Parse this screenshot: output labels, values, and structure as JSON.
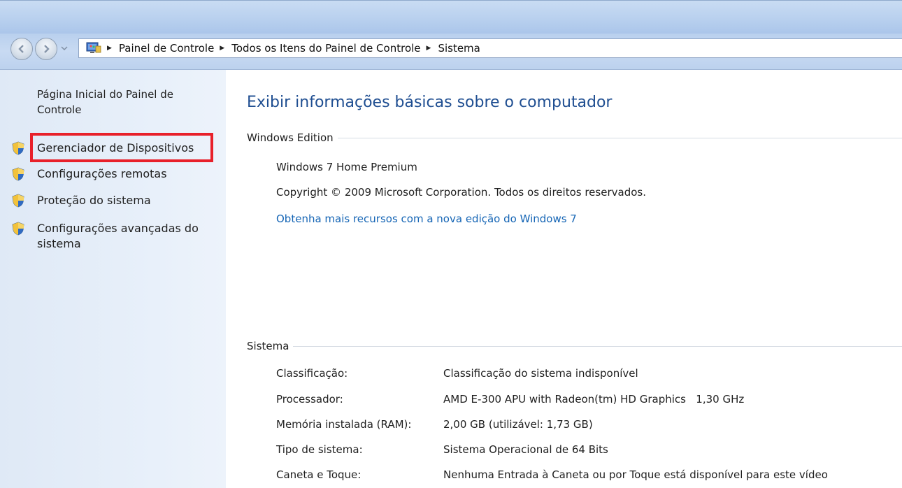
{
  "navigation": {
    "breadcrumbs": [
      "Painel de Controle",
      "Todos os Itens do Painel de Controle",
      "Sistema"
    ]
  },
  "sidebar": {
    "home_label": "Página Inicial do Painel de Controle",
    "items": [
      {
        "label": "Gerenciador de Dispositivos",
        "icon": "uac-shield-icon",
        "highlighted": true
      },
      {
        "label": "Configurações remotas",
        "icon": "uac-shield-icon"
      },
      {
        "label": "Proteção do sistema",
        "icon": "uac-shield-icon"
      },
      {
        "label": "Configurações avançadas do sistema",
        "icon": "uac-shield-icon"
      }
    ]
  },
  "main": {
    "title": "Exibir informações básicas sobre o computador",
    "windows_edition": {
      "heading": "Windows Edition",
      "edition": "Windows 7 Home Premium",
      "copyright": "Copyright © 2009 Microsoft Corporation. Todos os direitos reservados.",
      "upgrade_link": "Obtenha mais recursos com a nova edição do Windows 7"
    },
    "system": {
      "heading": "Sistema",
      "rows": [
        {
          "label": "Classificação:",
          "value": "Classificação do sistema indisponível",
          "is_link": true
        },
        {
          "label": "Processador:",
          "value": "AMD E-300 APU with Radeon(tm) HD Graphics   1,30 GHz"
        },
        {
          "label": "Memória instalada (RAM):",
          "value": "2,00 GB (utilizável: 1,73 GB)"
        },
        {
          "label": "Tipo de sistema:",
          "value": "Sistema Operacional de 64 Bits"
        },
        {
          "label": "Caneta e Toque:",
          "value": "Nenhuma Entrada à Caneta ou por Toque está disponível para este vídeo"
        }
      ]
    }
  },
  "colors": {
    "title_blue": "#1f4e91",
    "link_blue": "#1565b5",
    "highlight_red": "#e8202a"
  }
}
